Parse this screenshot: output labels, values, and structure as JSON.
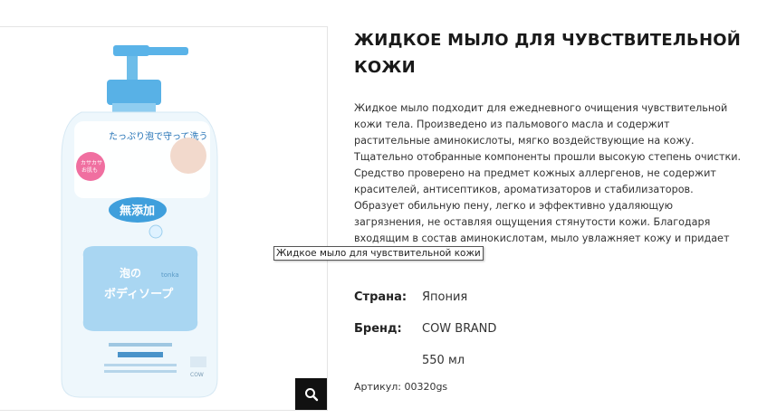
{
  "product": {
    "title": "ЖИДКОЕ МЫЛО ДЛЯ ЧУВСТВИТЕЛЬНОЙ КОЖИ",
    "description": "Жидкое мыло подходит для ежедневного очищения чувствительной кожи тела. Произведено из пальмового масла и содержит растительные аминокислоты, мягко воздействующие на кожу. Тщательно отобранные компоненты прошли высокую степень очистки. Средство проверено на предмет кожных аллергенов, не содержит красителей, антисептиков, ароматизаторов и стабилизаторов. Образует обильную пену, легко и эффективно удаляющую загрязнения, не оставляя ощущения стянутости кожи. Благодаря входящим в состав аминокислотам, мыло увлажняет кожу и придает ей гладкость.",
    "properties": [
      {
        "label": "Страна:",
        "value": "Япония"
      },
      {
        "label": "Бренд:",
        "value": "COW BRAND"
      },
      {
        "label": "",
        "value": "550 мл"
      }
    ],
    "sku": "Артикул: 00320gs",
    "tooltip": "Жидкое мыло для чувствительной кожи"
  },
  "image": {
    "alt": "Жидкое мыло для чувствительной кожи",
    "label_lines": [
      "泡の",
      "ボディソープ"
    ],
    "badge": "無添加",
    "top_text": "たっぷり泡で守って洗う",
    "cap_sticker": "カサカサお肌も",
    "brand_text": "COW"
  },
  "zoom_icon": "search-icon",
  "colors": {
    "accent": "#111111",
    "bottle_blue": "#4aa8e0",
    "label_blue": "#a9d6f2"
  }
}
